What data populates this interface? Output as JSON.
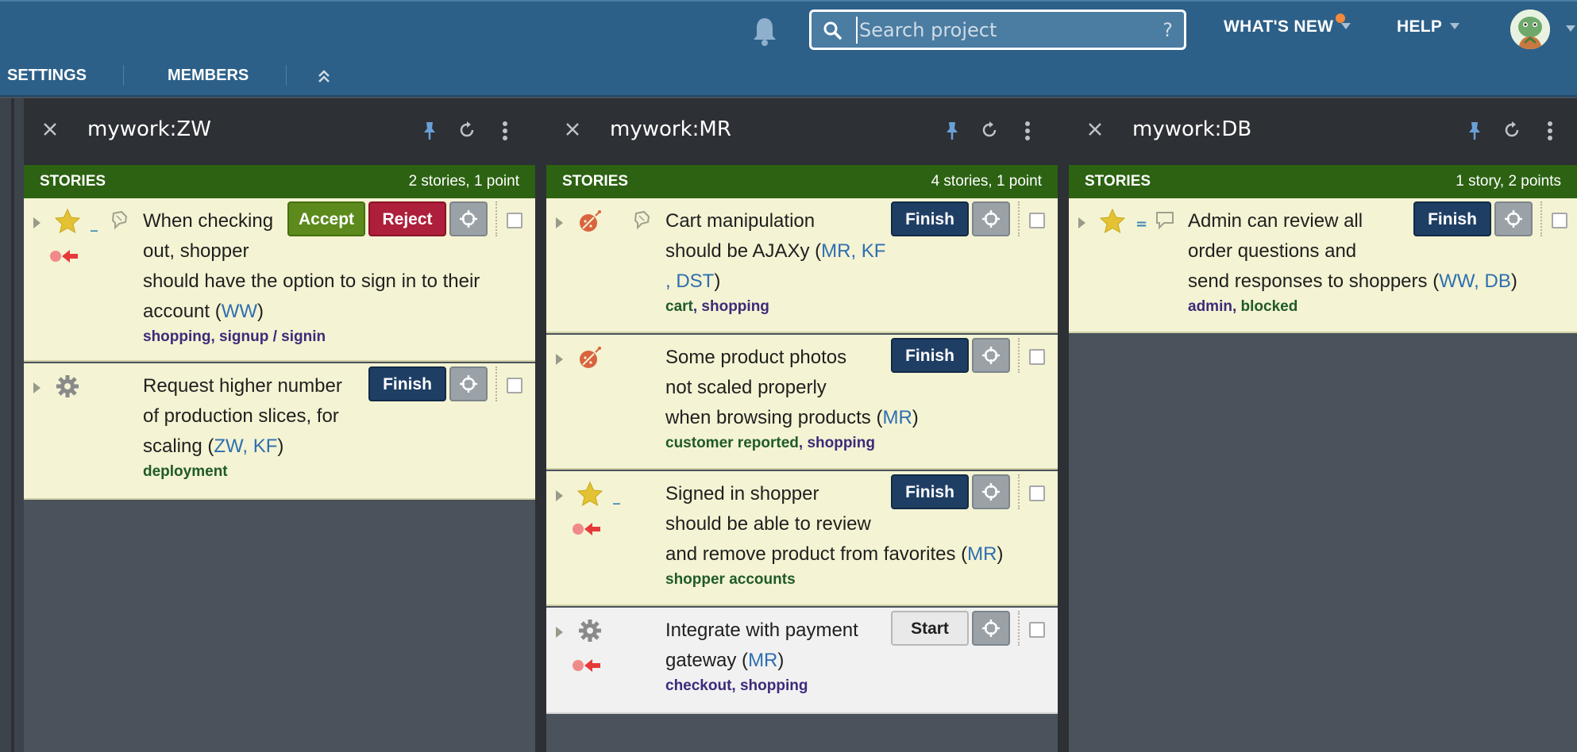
{
  "header": {
    "search": {
      "placeholder": "Search project",
      "help_glyph": "?"
    },
    "nav": [
      {
        "label": "WHAT'S NEW"
      },
      {
        "label": "HELP"
      }
    ],
    "icons": [
      "bell-icon",
      "search-icon",
      "avatar",
      "chevron-down-icon"
    ]
  },
  "subnav": {
    "items": [
      {
        "label": "SETTINGS"
      },
      {
        "label": "MEMBERS"
      }
    ],
    "collapse_icon": "double-chevron-up-icon"
  },
  "colors": {
    "topbar": "#2d6088",
    "panel_header": "#2d3034",
    "stories_bar": "#2c6212",
    "story_bg": "#f4f3d3",
    "accept": "#5c8a1c",
    "reject": "#ad1f3a",
    "finish": "#1f3e64",
    "owner_link": "#2e6fb0",
    "new_dot": "#f08a3a"
  },
  "panels": [
    {
      "title": "mywork:ZW",
      "section_label": "STORIES",
      "count": "2 stories, 1 point",
      "stories": [
        {
          "type": "feature",
          "estimate": "_",
          "title_lines": [
            "When checking",
            "out, shopper",
            "should have the option to sign in to their",
            "account ("
          ],
          "owners": "WW",
          "close": ")",
          "labels": [
            {
              "text": "shopping",
              "color": "purple"
            },
            {
              "text": ", ",
              "color": "purple"
            },
            {
              "text": "signup / signin",
              "color": "purple"
            }
          ],
          "buttons": [
            "Accept",
            "Reject"
          ]
        },
        {
          "type": "chore",
          "title_lines": [
            "Request higher number",
            "of production slices, for",
            "scaling ("
          ],
          "owners": "ZW, KF",
          "close": ")",
          "labels": [
            {
              "text": "deployment",
              "color": "green"
            }
          ],
          "buttons": [
            "Finish"
          ]
        }
      ]
    },
    {
      "title": "mywork:MR",
      "section_label": "STORIES",
      "count": "4 stories, 1 point",
      "stories": [
        {
          "type": "bug",
          "title_lines": [
            "Cart manipulation",
            "should be AJAXy ("
          ],
          "owners_line1": "MR, KF",
          "owners_line2": ", DST",
          "close": ")",
          "labels": [
            {
              "text": "cart",
              "color": "green"
            },
            {
              "text": ", ",
              "color": "purple"
            },
            {
              "text": "shopping",
              "color": "purple"
            }
          ],
          "buttons": [
            "Finish"
          ]
        },
        {
          "type": "bug",
          "title_lines": [
            "Some product photos",
            "not scaled properly",
            "when browsing products ("
          ],
          "owners": "MR",
          "close": ")",
          "labels": [
            {
              "text": "customer reported",
              "color": "green"
            },
            {
              "text": ", ",
              "color": "purple"
            },
            {
              "text": "shopping",
              "color": "purple"
            }
          ],
          "buttons": [
            "Finish"
          ]
        },
        {
          "type": "feature",
          "estimate": "_",
          "title_lines": [
            "Signed in shopper",
            "should be able to review",
            "and remove product from favorites ("
          ],
          "owners": "MR",
          "close": ")",
          "labels": [
            {
              "text": "shopper accounts",
              "color": "green"
            }
          ],
          "buttons": [
            "Finish"
          ]
        },
        {
          "type": "chore",
          "title_lines": [
            "Integrate with payment",
            "gateway ("
          ],
          "owners": "MR",
          "close": ")",
          "labels": [
            {
              "text": "checkout",
              "color": "purple"
            },
            {
              "text": ", ",
              "color": "purple"
            },
            {
              "text": "shopping",
              "color": "purple"
            }
          ],
          "buttons": [
            "Start"
          ]
        }
      ]
    },
    {
      "title": "mywork:DB",
      "section_label": "STORIES",
      "count": "1 story, 2 points",
      "stories": [
        {
          "type": "feature",
          "estimate": "=",
          "title_lines": [
            "Admin can review all",
            "order questions and",
            "send responses to shoppers ("
          ],
          "owners": "WW, DB",
          "close": ")",
          "labels": [
            {
              "text": "admin",
              "color": "purple"
            },
            {
              "text": ", ",
              "color": "purple"
            },
            {
              "text": "blocked",
              "color": "green"
            }
          ],
          "buttons": [
            "Finish"
          ]
        }
      ]
    }
  ]
}
